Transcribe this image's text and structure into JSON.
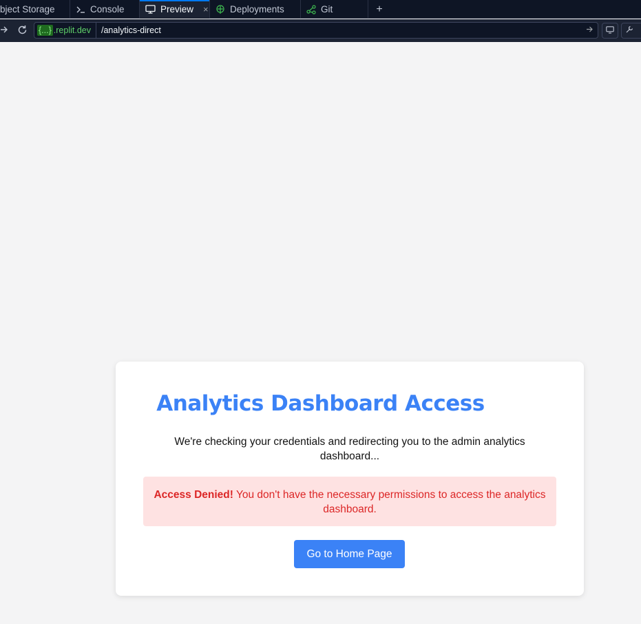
{
  "tabs": [
    {
      "label": "bject Storage",
      "icon": "object-storage-icon"
    },
    {
      "label": "Console",
      "icon": "terminal-icon"
    },
    {
      "label": "Preview",
      "icon": "monitor-icon",
      "active": true
    },
    {
      "label": "Deployments",
      "icon": "deploy-icon"
    },
    {
      "label": "Git",
      "icon": "git-icon"
    }
  ],
  "tab_add_label": "+",
  "url": {
    "braces": "{...}",
    "domain_suffix": ".replit.dev",
    "path": "/analytics-direct"
  },
  "page": {
    "title": "Analytics Dashboard Access",
    "message": "We're checking your credentials and redirecting you to the admin analytics dashboard...",
    "alert_strong": "Access Denied!",
    "alert_text": " You don't have the necessary permissions to access the analytics dashboard.",
    "button_label": "Go to Home Page"
  },
  "colors": {
    "accent": "#3b82f6",
    "alert_bg": "#fee2e2",
    "alert_text": "#dc2626",
    "ide_bg": "#0e1525"
  }
}
